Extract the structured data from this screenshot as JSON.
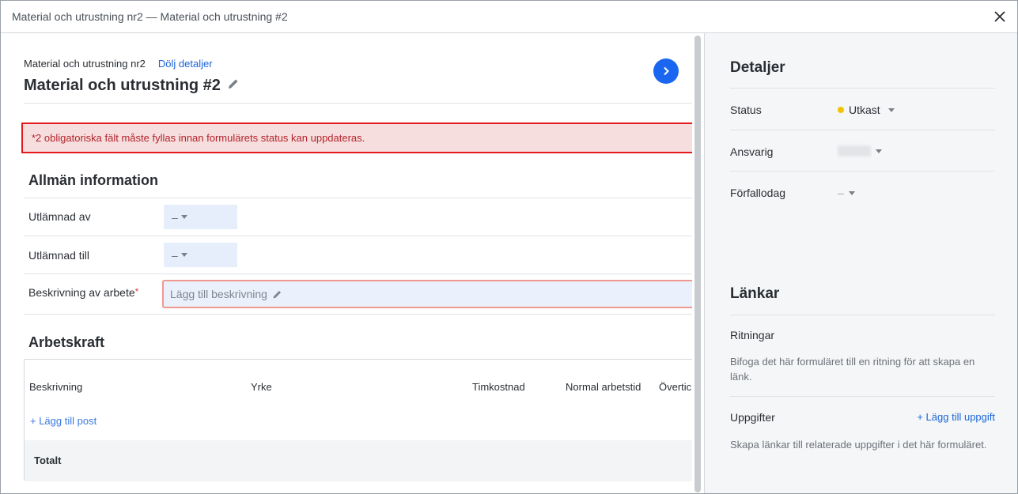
{
  "window": {
    "title": "Material och utrustning nr2 — Material och utrustning #2"
  },
  "header": {
    "breadcrumb": "Material och utrustning nr2",
    "toggle_details": "Dölj detaljer",
    "form_title": "Material och utrustning #2"
  },
  "alert": {
    "text": "*2 obligatoriska fält måste fyllas innan formulärets status kan uppdateras."
  },
  "general": {
    "title": "Allmän information",
    "fields": [
      {
        "label": "Utlämnad av",
        "value": "–"
      },
      {
        "label": "Utlämnad till",
        "value": "–"
      }
    ],
    "description": {
      "label": "Beskrivning av arbete",
      "required_mark": "*",
      "placeholder": "Lägg till beskrivning"
    }
  },
  "labor": {
    "title": "Arbetskraft",
    "columns": [
      "Beskrivning",
      "Yrke",
      "Timkostnad",
      "Normal arbetstid",
      "Övertic"
    ],
    "add_post": "+ Lägg till post",
    "total": "Totalt"
  },
  "details": {
    "title": "Detaljer",
    "status_label": "Status",
    "status_value": "Utkast",
    "status_color": "#f2c200",
    "responsible_label": "Ansvarig",
    "due_label": "Förfallodag",
    "due_value": "–"
  },
  "links": {
    "title": "Länkar",
    "drawings_label": "Ritningar",
    "drawings_text": "Bifoga det här formuläret till en ritning för att skapa en länk.",
    "tasks_label": "Uppgifter",
    "tasks_add": "+ Lägg till uppgift",
    "tasks_text": "Skapa länkar till relaterade uppgifter i det här formuläret."
  }
}
